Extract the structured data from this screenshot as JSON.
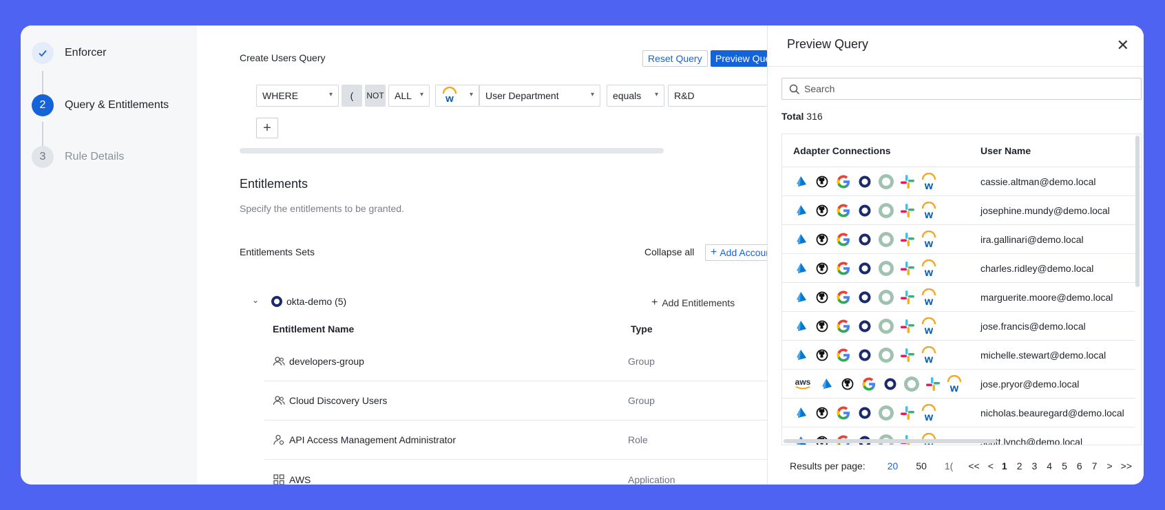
{
  "stepper": {
    "steps": [
      {
        "label": "Enforcer",
        "state": "done"
      },
      {
        "label": "Query & Entitlements",
        "number": "2",
        "state": "active"
      },
      {
        "label": "Rule Details",
        "number": "3",
        "state": "pending"
      }
    ]
  },
  "query": {
    "title": "Create Users Query",
    "reset_label": "Reset Query",
    "preview_label": "Preview Query",
    "where_value": "WHERE",
    "paren_label": "(",
    "not_label": "NOT",
    "all_value": "ALL",
    "field_value": "User Department",
    "operator_value": "equals",
    "input_value": "R&D",
    "add_label": "+"
  },
  "entitlements": {
    "heading": "Entitlements",
    "description": "Specify the entitlements to be granted.",
    "sets_label": "Entitlements Sets",
    "collapse_label": "Collapse all",
    "add_account_label": "Add Account",
    "group_name": "okta-demo (5)",
    "add_entitlements_label": "Add Entitlements",
    "col_name": "Entitlement Name",
    "col_type": "Type",
    "rows": [
      {
        "name": "developers-group",
        "type": "Group",
        "icon": "users-icon"
      },
      {
        "name": "Cloud Discovery Users",
        "type": "Group",
        "icon": "users-icon"
      },
      {
        "name": "API Access Management Administrator",
        "type": "Role",
        "icon": "user-role-icon"
      },
      {
        "name": "AWS",
        "type": "Application",
        "icon": "grid-icon"
      }
    ]
  },
  "preview": {
    "title": "Preview Query",
    "search_placeholder": "Search",
    "total_label": "Total",
    "total_value": "316",
    "col_adapters": "Adapter Connections",
    "col_user": "User Name",
    "rows": [
      {
        "user": "cassie.altman@demo.local",
        "aws": false
      },
      {
        "user": "josephine.mundy@demo.local",
        "aws": false
      },
      {
        "user": "ira.gallinari@demo.local",
        "aws": false
      },
      {
        "user": "charles.ridley@demo.local",
        "aws": false
      },
      {
        "user": "marguerite.moore@demo.local",
        "aws": false
      },
      {
        "user": "jose.francis@demo.local",
        "aws": false
      },
      {
        "user": "michelle.stewart@demo.local",
        "aws": false
      },
      {
        "user": "jose.pryor@demo.local",
        "aws": true
      },
      {
        "user": "nicholas.beauregard@demo.local",
        "aws": false
      },
      {
        "user": "scott.lynch@demo.local",
        "aws": false
      }
    ],
    "pager": {
      "per_page_label": "Results per page:",
      "per_page_options": [
        "20",
        "50",
        "1("
      ],
      "first": "<<",
      "prev": "<",
      "pages": [
        "1",
        "2",
        "3",
        "4",
        "5",
        "6",
        "7"
      ],
      "current_page": "1",
      "next": ">",
      "last": ">>"
    }
  },
  "colors": {
    "accent": "#1563d9",
    "background": "#4f63f3",
    "okta": "#1a2a6c"
  }
}
